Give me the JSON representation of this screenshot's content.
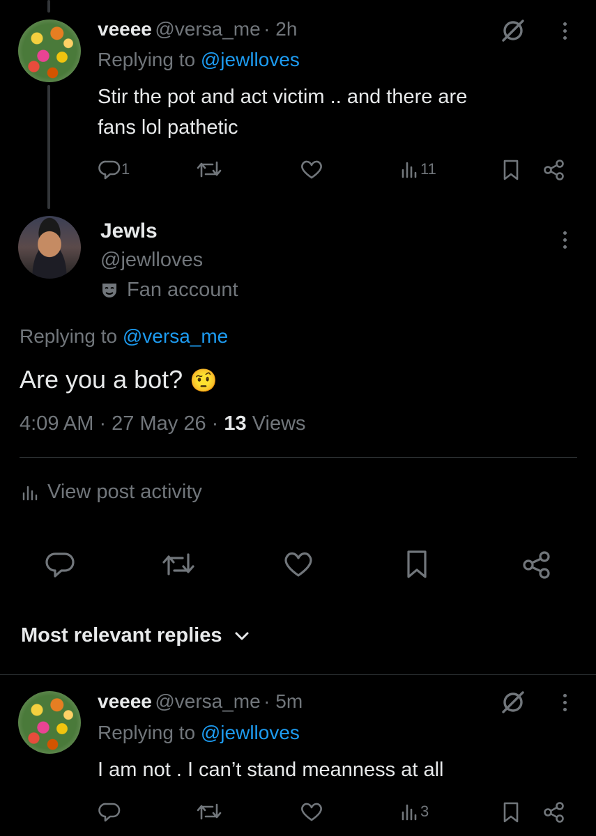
{
  "post1": {
    "name": "veeee",
    "handle": "@versa_me",
    "time": "· 2h",
    "replying_prefix": "Replying to",
    "replying_to": "@jewlloves",
    "text_line1": "Stir the pot and act victim .. and there are",
    "text_line2": "fans lol pathetic",
    "reply_count": "1",
    "views": "11"
  },
  "main_post": {
    "name": "Jewls",
    "handle": "@jewlloves",
    "label": "Fan account",
    "replying_prefix": "Replying to",
    "replying_to": "@versa_me",
    "text": "Are you a bot?",
    "emoji": "🤨",
    "timestamp": "4:09 AM · 27 May 26 ·",
    "views_count": "13",
    "views_label": "Views",
    "activity_label": "View post activity"
  },
  "replies_header": {
    "label": "Most relevant replies"
  },
  "post2": {
    "name": "veeee",
    "handle": "@versa_me",
    "time": "· 5m",
    "replying_prefix": "Replying to",
    "replying_to": "@jewlloves",
    "text": "I am not . I can’t stand meanness at all",
    "views": "3"
  },
  "colors": {
    "background": "#000000",
    "text": "#e7e9ea",
    "secondary": "#71767b",
    "link": "#1d9bf0",
    "divider": "#2f3336"
  }
}
